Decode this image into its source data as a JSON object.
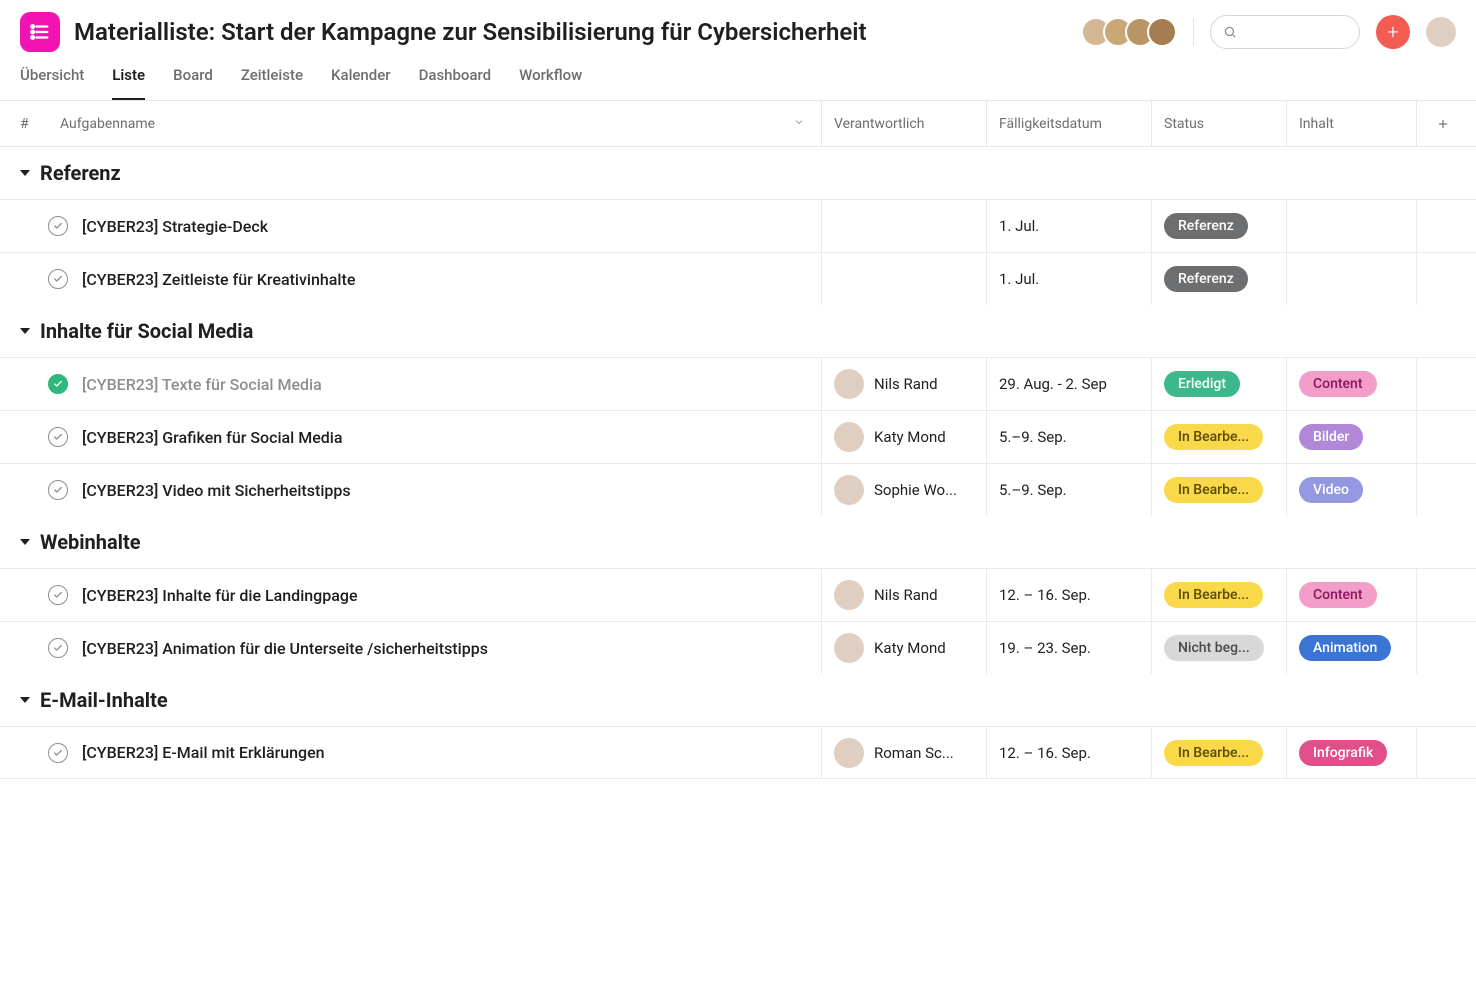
{
  "header": {
    "title": "Materialliste: Start der Kampagne zur Sensibilisierung für Cybersicherheit"
  },
  "tabs": [
    {
      "label": "Übersicht",
      "active": false
    },
    {
      "label": "Liste",
      "active": true
    },
    {
      "label": "Board",
      "active": false
    },
    {
      "label": "Zeitleiste",
      "active": false
    },
    {
      "label": "Kalender",
      "active": false
    },
    {
      "label": "Dashboard",
      "active": false
    },
    {
      "label": "Workflow",
      "active": false
    }
  ],
  "columns": {
    "num": "#",
    "name": "Aufgabenname",
    "assignee": "Verantwortlich",
    "due": "Fälligkeitsdatum",
    "status": "Status",
    "content": "Inhalt"
  },
  "status_colors": {
    "Referenz": {
      "bg": "#6d6e6f",
      "fg": "#ffffff"
    },
    "Erledigt": {
      "bg": "#3db88b",
      "fg": "#ffffff"
    },
    "In Bearbe...": {
      "bg": "#f9d94a",
      "fg": "#5a4a00"
    },
    "Nicht beg...": {
      "bg": "#d8d8d8",
      "fg": "#4a4a4a"
    }
  },
  "content_colors": {
    "Content": {
      "bg": "#f39dc9",
      "fg": "#8a1560"
    },
    "Bilder": {
      "bg": "#b188d8",
      "fg": "#ffffff"
    },
    "Video": {
      "bg": "#9398e0",
      "fg": "#ffffff"
    },
    "Animation": {
      "bg": "#3a75d4",
      "fg": "#ffffff"
    },
    "Infografik": {
      "bg": "#e04f8a",
      "fg": "#ffffff"
    }
  },
  "sections": [
    {
      "title": "Referenz",
      "tasks": [
        {
          "complete": false,
          "name": "[CYBER23] Strategie-Deck",
          "assignee": "",
          "due": "1. Jul.",
          "status": "Referenz",
          "content": ""
        },
        {
          "complete": false,
          "name": "[CYBER23] Zeitleiste für Kreativinhalte",
          "assignee": "",
          "due": "1. Jul.",
          "status": "Referenz",
          "content": ""
        }
      ]
    },
    {
      "title": "Inhalte für Social Media",
      "tasks": [
        {
          "complete": true,
          "name": "[CYBER23] Texte für Social Media",
          "assignee": "Nils Rand",
          "due": "29. Aug. - 2. Sep",
          "status": "Erledigt",
          "content": "Content"
        },
        {
          "complete": false,
          "name": "[CYBER23] Grafiken für Social Media",
          "assignee": "Katy Mond",
          "due": "5.–9. Sep.",
          "status": "In Bearbe...",
          "content": "Bilder"
        },
        {
          "complete": false,
          "name": "[CYBER23] Video mit Sicherheitstipps",
          "assignee": "Sophie Wo...",
          "due": "5.–9. Sep.",
          "status": "In Bearbe...",
          "content": "Video"
        }
      ]
    },
    {
      "title": "Webinhalte",
      "tasks": [
        {
          "complete": false,
          "name": "[CYBER23] Inhalte für die Landingpage",
          "assignee": "Nils Rand",
          "due": "12. – 16. Sep.",
          "status": "In Bearbe...",
          "content": "Content"
        },
        {
          "complete": false,
          "name": "[CYBER23] Animation für die Unterseite /sicherheitstipps",
          "assignee": "Katy Mond",
          "due": "19. – 23. Sep.",
          "status": "Nicht beg...",
          "content": "Animation"
        }
      ]
    },
    {
      "title": "E-Mail-Inhalte",
      "tasks": [
        {
          "complete": false,
          "name": "[CYBER23] E-Mail mit Erklärungen",
          "assignee": "Roman Sc...",
          "due": "12. – 16. Sep.",
          "status": "In Bearbe...",
          "content": "Infografik"
        }
      ]
    }
  ]
}
